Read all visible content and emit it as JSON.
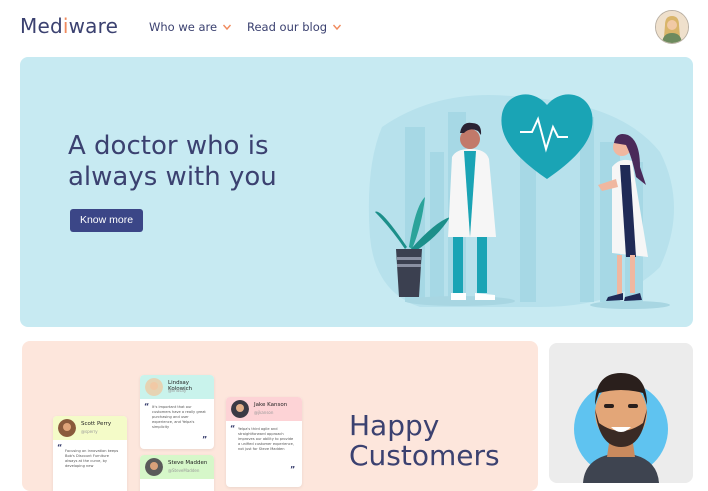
{
  "header": {
    "logo_prefix": "Med",
    "logo_accent": "i",
    "logo_suffix": "ware",
    "nav": [
      {
        "label": "Who we are"
      },
      {
        "label": "Read our blog"
      }
    ]
  },
  "hero": {
    "title_line1": "A doctor who is",
    "title_line2": "always with you",
    "cta_label": "Know more"
  },
  "testimonials_card": {
    "heading_line1": "Happy",
    "heading_line2": "Customers",
    "cards": [
      {
        "name": "Scott Perry",
        "handle": "@sperry",
        "text": "Focusing on innovation keeps Bob's Discount Furniture always at the curve, by developing new"
      },
      {
        "name": "Lindsay Kolowich",
        "handle": "@lindsay",
        "text": "It's important that our customers have a really great purchasing and user experience, and Yelpa's simplicity"
      },
      {
        "name": "Jake Kanson",
        "handle": "@jkanson",
        "text": "Yelpa's third agile and straightforward approach improves our ability to provide a unified customer experience, not just for Steve Madden"
      },
      {
        "name": "Steve Madden",
        "handle": "@SteveMadden",
        "text": ""
      }
    ]
  },
  "colors": {
    "brand": "#3b4170",
    "accent": "#f08a5d",
    "hero_bg": "#c7eaf2",
    "peach_bg": "#fde6dc",
    "button": "#3b4687",
    "heart": "#1aa4b5"
  }
}
